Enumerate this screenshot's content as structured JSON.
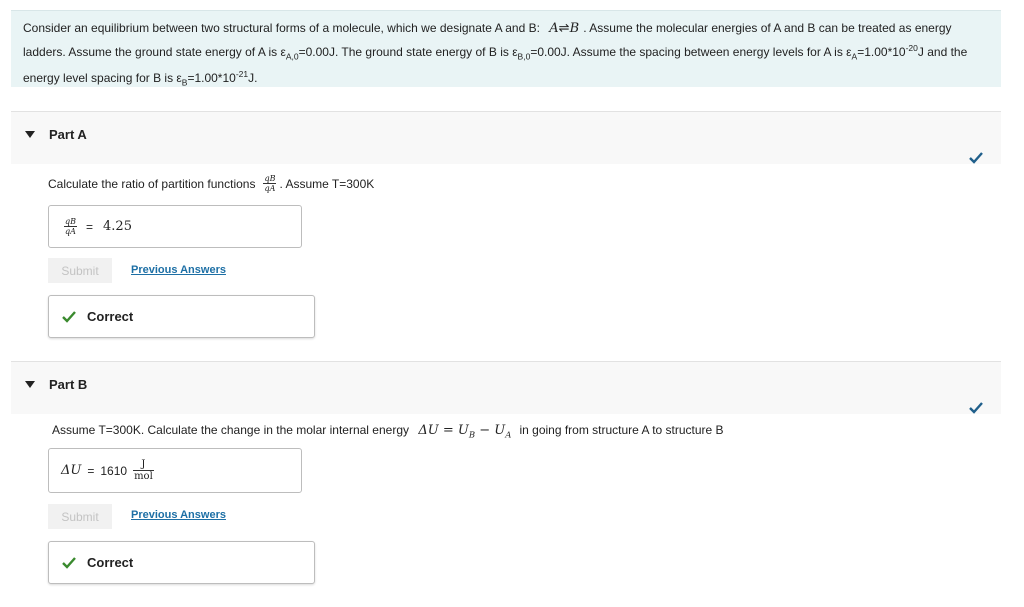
{
  "problem": {
    "line1a": "Consider an equilibrium between two structural forms of a molecule, which we designate A and B:",
    "reaction_a": "A",
    "reaction_arrow": "⇌",
    "reaction_b": "B",
    "line1b": ". Assume the molecular energies of A and B can be treated as energy",
    "line2a": "ladders. Assume the ground state energy of A is ε",
    "line2a_sub": "A,0",
    "line2b": "=0.00J. The ground state energy of B is ε",
    "line2b_sub": "B,0",
    "line2c": "=0.00J. Assume the spacing between energy levels for A is ε",
    "line2c_sub": "A",
    "line2d": "=1.00*10",
    "line2d_sup": "-20",
    "line2e": "J and the",
    "line3a": "energy level spacing for B is ε",
    "line3a_sub": "B",
    "line3b": "=1.00*10",
    "line3b_sup": "-21",
    "line3c": "J."
  },
  "partA": {
    "title": "Part A",
    "question_a": "Calculate the ratio of partition functions",
    "frac_num": "qB",
    "frac_den": "qA",
    "question_b": ". Assume T=300K",
    "answer_value": "4.25",
    "equals": "=",
    "submit_label": "Submit",
    "prev_label": "Previous Answers",
    "correct_label": "Correct"
  },
  "partB": {
    "title": "Part B",
    "question_a": "Assume T=300K. Calculate the change in the molar internal energy",
    "math_expr": "ΔU = U",
    "math_sub1": "B",
    "math_mid": " − U",
    "math_sub2": "A",
    "question_b": "in going from structure A to structure B",
    "answer_symbol": "ΔU",
    "equals": "=",
    "answer_value": "1610",
    "unit_num": "J",
    "unit_den": "mol",
    "submit_label": "Submit",
    "prev_label": "Previous Answers",
    "correct_label": "Correct"
  },
  "colors": {
    "problem_bg": "#e9f4f5",
    "link": "#1d6fa5",
    "check_green": "#3a8a2e",
    "check_blue": "#1f5f8b"
  }
}
